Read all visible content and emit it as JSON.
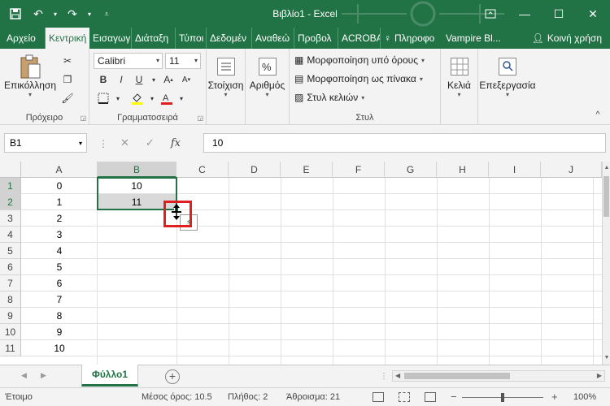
{
  "window": {
    "title": "Βιβλίο1 - Excel",
    "accent": "#217346"
  },
  "tabs": [
    {
      "label": "Αρχείο"
    },
    {
      "label": "Κεντρική"
    },
    {
      "label": "Εισαγωγ"
    },
    {
      "label": "Διάταξη"
    },
    {
      "label": "Τύποι"
    },
    {
      "label": "Δεδομέν"
    },
    {
      "label": "Αναθεώ"
    },
    {
      "label": "Προβολ"
    },
    {
      "label": "ACROBA"
    },
    {
      "label": "Πληροφο"
    },
    {
      "label": "Vampire Bl..."
    },
    {
      "label": "Κοινή χρήση"
    }
  ],
  "ribbon": {
    "clipboard": {
      "paste_label": "Επικόλληση",
      "group_label": "Πρόχειρο"
    },
    "font": {
      "font_name": "Calibri",
      "font_size": "11",
      "group_label": "Γραμματοσειρά",
      "bold": "B",
      "italic": "I",
      "underline": "U"
    },
    "alignment": {
      "label": "Στοίχιση"
    },
    "number": {
      "label": "Αριθμός"
    },
    "styles": {
      "conditional": "Μορφοποίηση υπό όρους",
      "as_table": "Μορφοποίηση ως πίνακα",
      "cell_styles": "Στυλ κελιών",
      "group_label": "Στυλ"
    },
    "cells": {
      "label": "Κελιά"
    },
    "editing": {
      "label": "Επεξεργασία"
    }
  },
  "formula_bar": {
    "name_box": "B1",
    "fx": "fx",
    "formula": "10"
  },
  "grid": {
    "columns": [
      "A",
      "B",
      "C",
      "D",
      "E",
      "F",
      "G",
      "H",
      "I",
      "J"
    ],
    "rows": [
      "1",
      "2",
      "3",
      "4",
      "5",
      "6",
      "7",
      "8",
      "9",
      "10",
      "11"
    ],
    "column_a": [
      "0",
      "1",
      "2",
      "3",
      "4",
      "5",
      "6",
      "7",
      "8",
      "9",
      "10"
    ],
    "column_b": [
      "10",
      "11"
    ]
  },
  "sheets": {
    "active": "Φύλλο1"
  },
  "status": {
    "ready": "Έτοιμο",
    "average": "Μέσος όρος: 10.5",
    "count": "Πλήθος: 2",
    "sum": "Άθροισμα: 21",
    "zoom": "100%"
  }
}
